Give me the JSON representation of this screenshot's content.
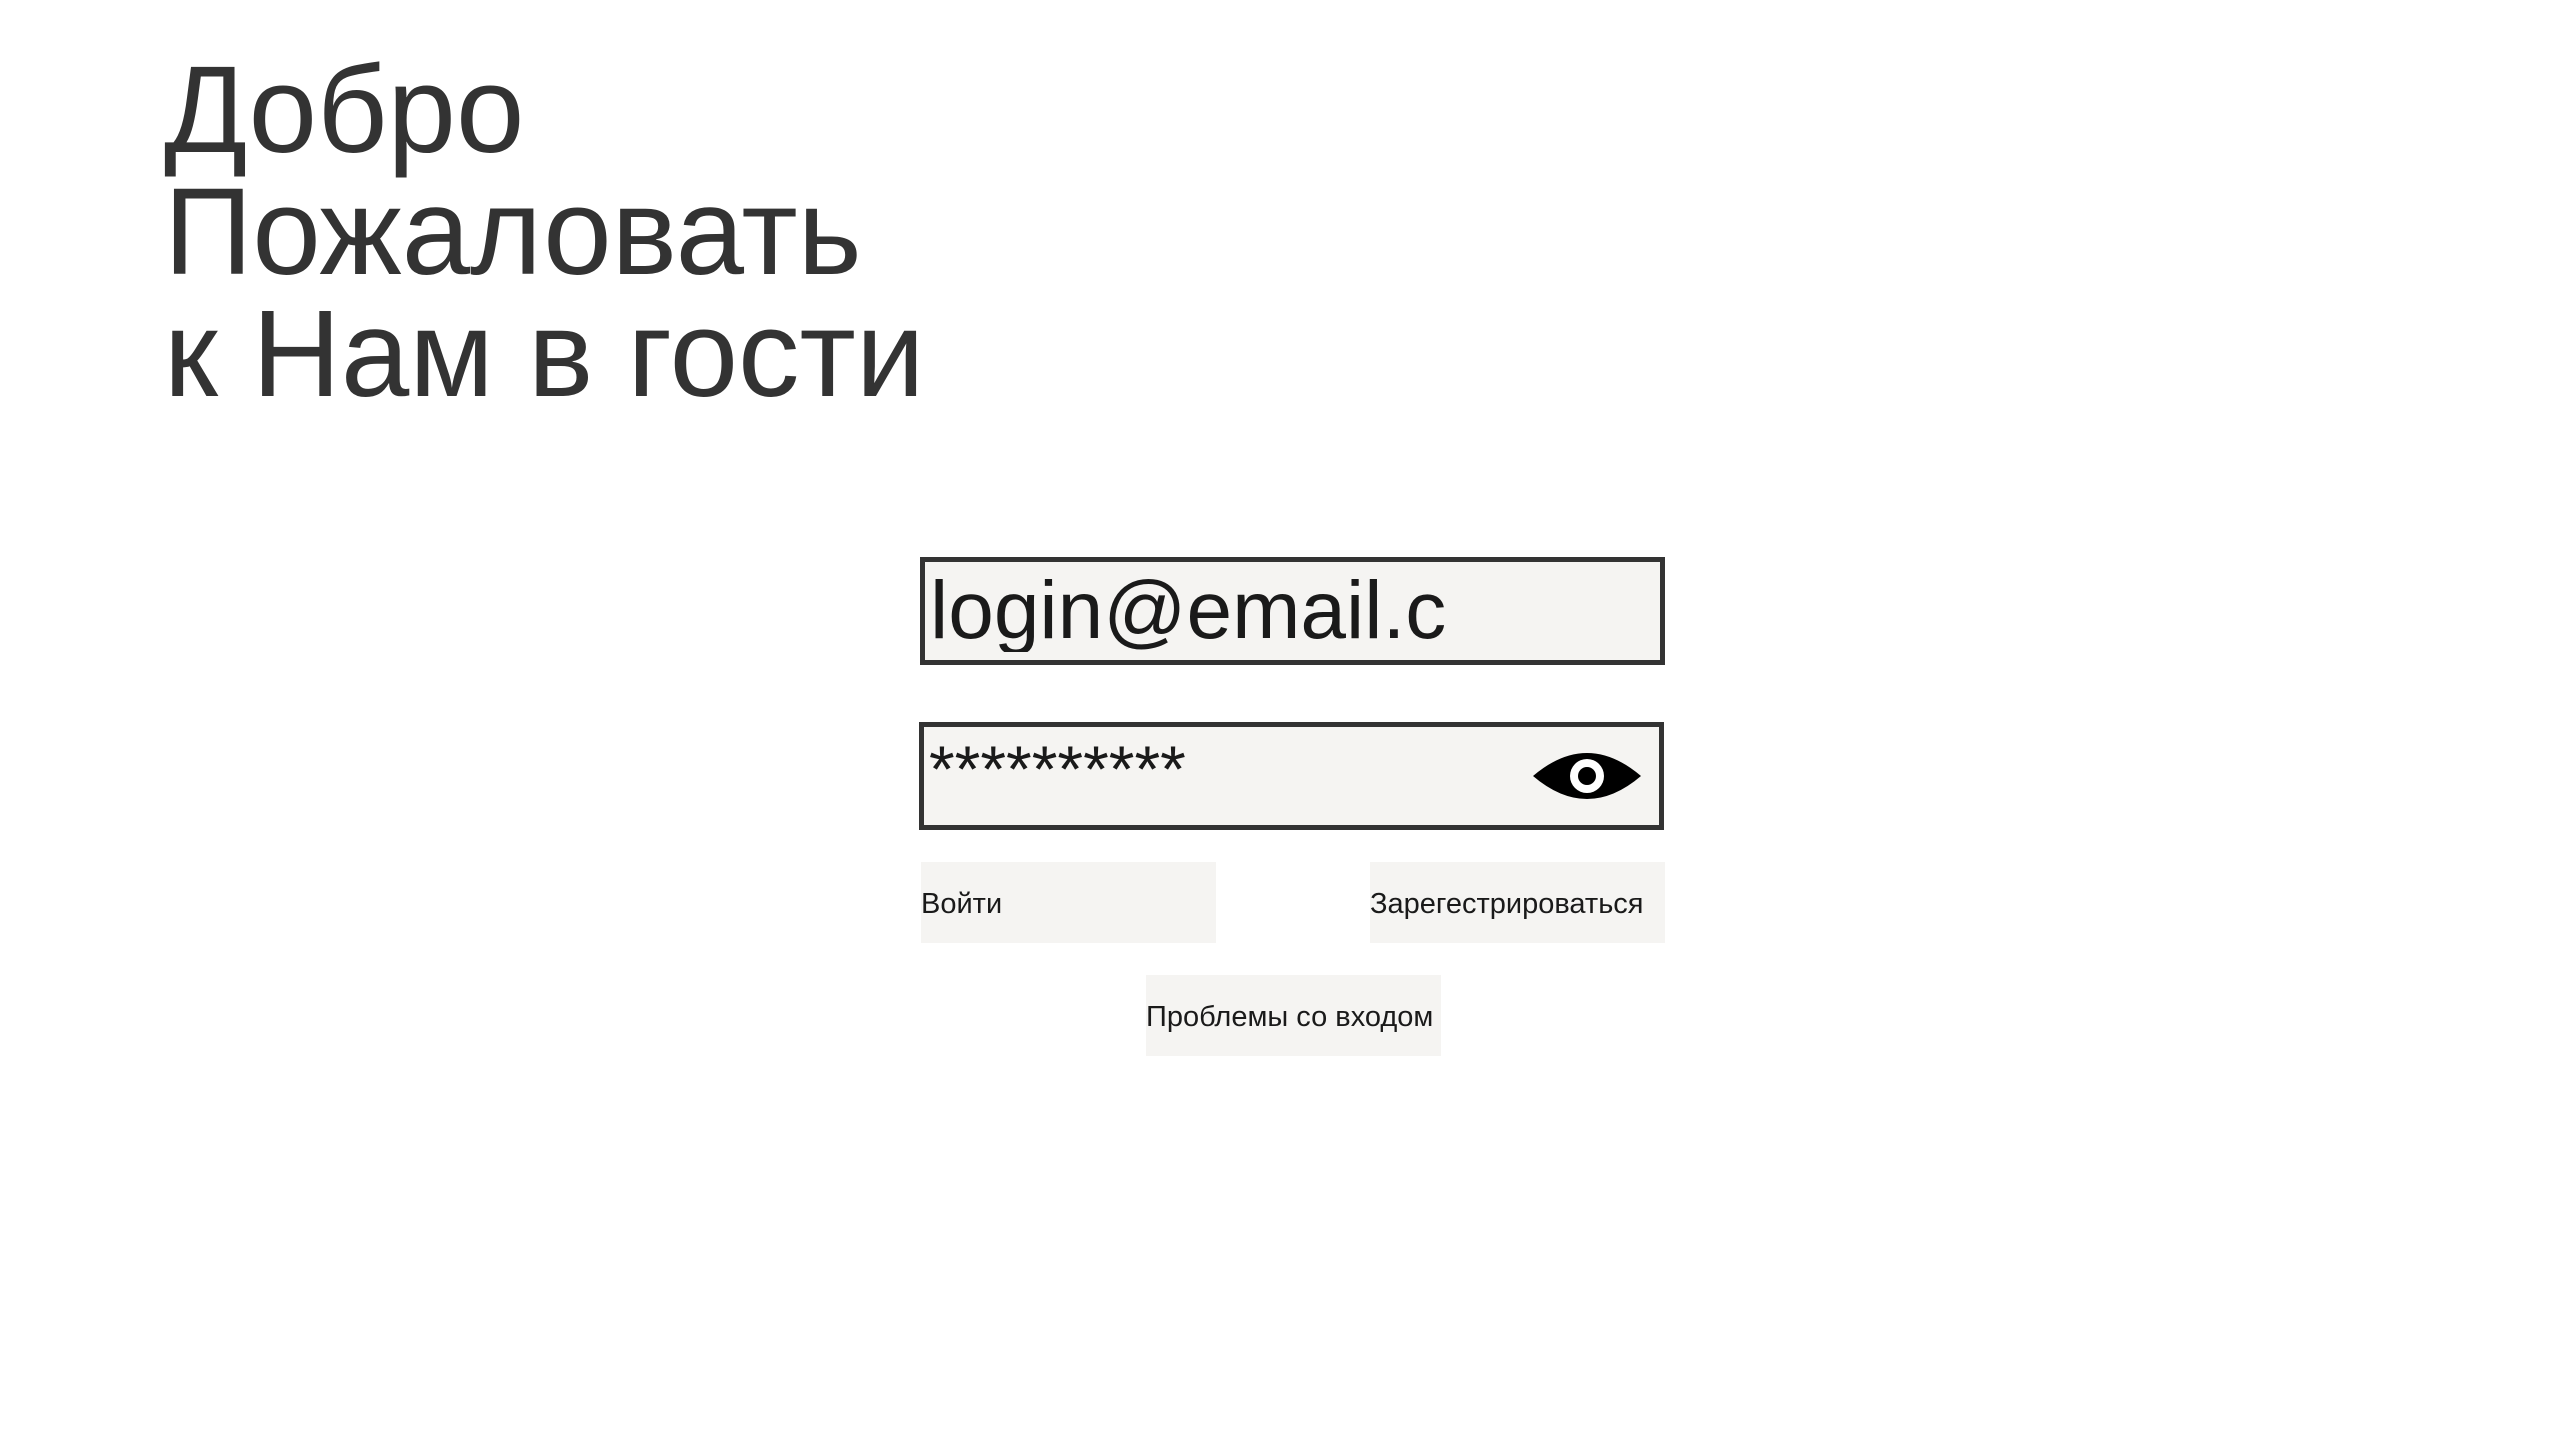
{
  "welcome": {
    "line1": "Добро",
    "line2": "Пожаловать",
    "line3": "к Нам в гости"
  },
  "login_form": {
    "email_value": "login@email.c",
    "password_masked": "**********",
    "password_toggle_icon": "eye-icon"
  },
  "actions": {
    "login_label": "Войти",
    "register_label": "Зарегестрироваться",
    "trouble_label": "Проблемы со входом"
  },
  "colors": {
    "text": "#333333",
    "field_background": "#f5f4f2",
    "field_border": "#333333"
  }
}
